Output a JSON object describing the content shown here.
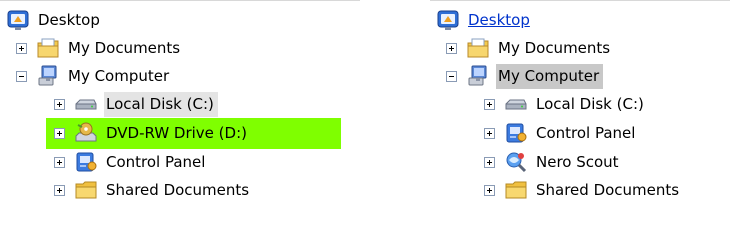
{
  "left_tree": {
    "desktop": "Desktop",
    "my_documents": "My Documents",
    "my_computer": "My Computer",
    "local_disk": "Local Disk (C:)",
    "dvd_drive": "DVD-RW Drive (D:)",
    "control_panel": "Control Panel",
    "shared_documents": "Shared Documents"
  },
  "right_tree": {
    "desktop": "Desktop",
    "my_documents": "My Documents",
    "my_computer": "My Computer",
    "local_disk": "Local Disk (C:)",
    "control_panel": "Control Panel",
    "nero_scout": "Nero Scout",
    "shared_documents": "Shared Documents"
  },
  "colors": {
    "highlight_green": "#7fff00",
    "selection_gray": "#e4e4e4",
    "selection_dark": "#c8c8c8",
    "link_blue": "#0033cc"
  },
  "icons": {
    "desktop": "desktop-icon",
    "documents": "my-documents-icon",
    "computer": "my-computer-icon",
    "disk": "local-disk-icon",
    "dvd": "dvd-drive-icon",
    "control_panel": "control-panel-icon",
    "nero": "nero-scout-icon",
    "folder": "shared-folder-icon"
  }
}
